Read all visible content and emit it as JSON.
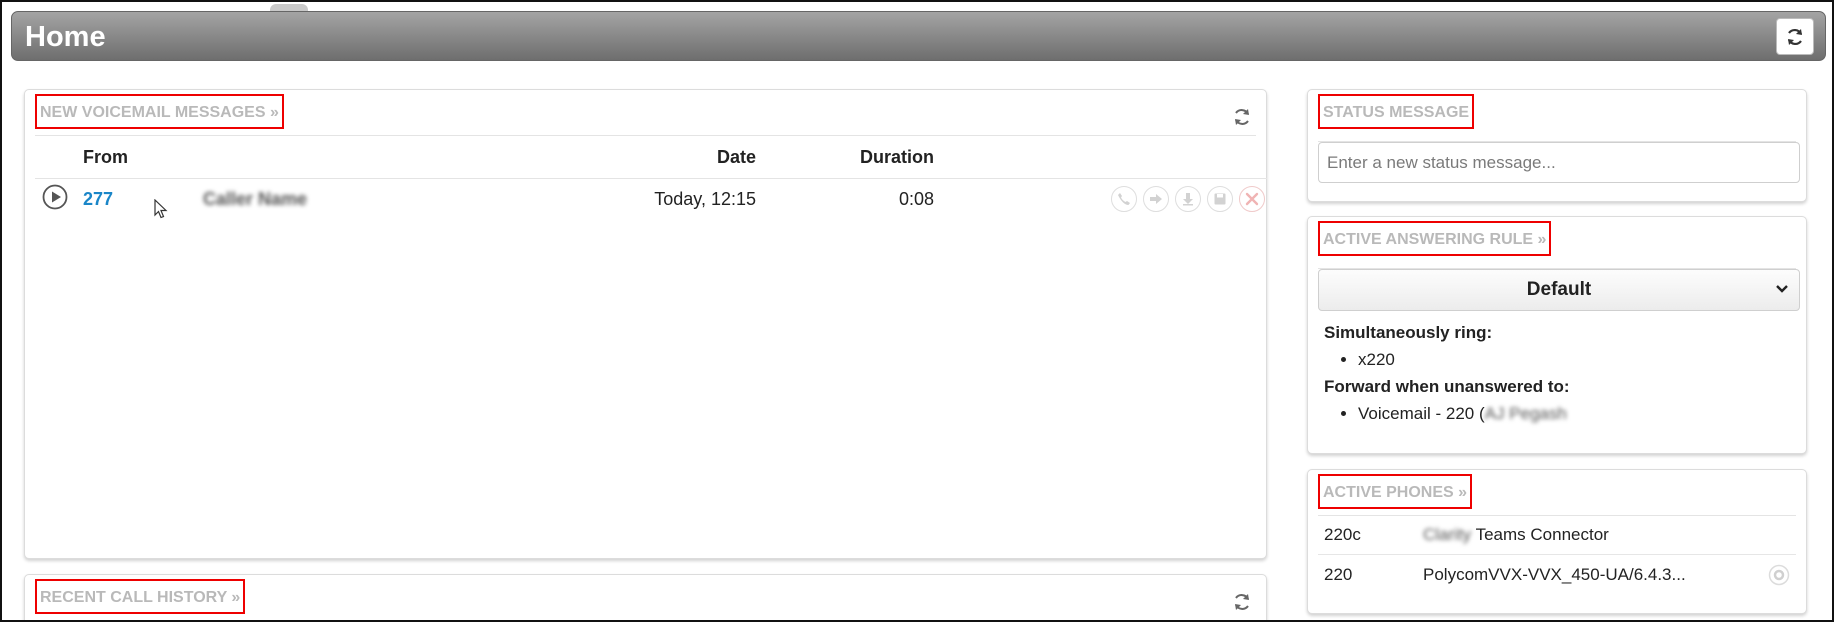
{
  "header": {
    "title": "Home"
  },
  "voicemail": {
    "title": "NEW VOICEMAIL MESSAGES »",
    "columns": {
      "from": "From",
      "date": "Date",
      "duration": "Duration"
    },
    "rows": [
      {
        "number": "277",
        "caller_name": "Caller Name",
        "date": "Today, 12:15",
        "duration": "0:08"
      }
    ]
  },
  "status": {
    "title": "STATUS MESSAGE",
    "placeholder": "Enter a new status message..."
  },
  "rule": {
    "title": "ACTIVE ANSWERING RULE »",
    "selected": "Default",
    "sim_label": "Simultaneously ring:",
    "sim_items": [
      "x220"
    ],
    "fwd_label": "Forward when unanswered to:",
    "fwd_prefix": "Voicemail - 220 (",
    "fwd_name": "AJ Pegash"
  },
  "phones": {
    "title": "ACTIVE PHONES »",
    "rows": [
      {
        "ext": "220c",
        "name_blur": "Clarity",
        "name": "Teams Connector"
      },
      {
        "ext": "220",
        "name_blur": "",
        "name": "PolycomVVX-VVX_450-UA/6.4.3..."
      }
    ]
  },
  "history": {
    "title": "RECENT CALL HISTORY »"
  },
  "icons": {
    "refresh": "refresh-icon",
    "play": "play-icon",
    "call": "phone-icon",
    "forward": "forward-icon",
    "download": "download-icon",
    "save": "save-icon",
    "delete": "delete-icon",
    "gear": "gear-icon",
    "chevron": "chevron-down-icon",
    "cursor": "mouse-cursor-icon"
  }
}
